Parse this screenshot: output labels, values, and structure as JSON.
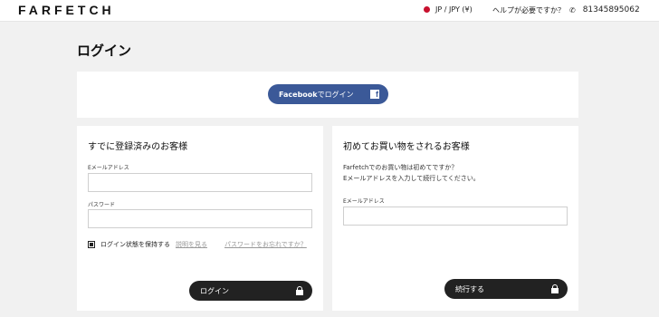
{
  "header": {
    "logo": "FARFETCH",
    "locale": "JP / JPY (¥)",
    "help": "ヘルプが必要ですか？",
    "phone": "81345895062",
    "icons": {
      "flag": "japan-flag-icon",
      "phone": "phone-icon"
    },
    "colors": {
      "flag": "#c8102e"
    }
  },
  "page": {
    "title": "ログイン"
  },
  "facebook": {
    "brand": "Facebook",
    "label": "でログイン",
    "icon_letter": "f",
    "color": "#3b5998"
  },
  "existing_customer": {
    "title": "すでに登録済みのお客様",
    "email_label": "Eメールアドレス",
    "email_value": "",
    "password_label": "パスワード",
    "password_value": "",
    "remember_label": "ログイン状態を保持する",
    "remember_checked": true,
    "explain_link": "説明を見る",
    "forgot_link": "パスワードをお忘れですか？",
    "login_button": "ログイン"
  },
  "new_customer": {
    "title": "初めてお買い物をされるお客様",
    "intro_line1": "Farfetchでのお買い物は初めてですか？",
    "intro_line2": "Eメールアドレスを入力して続行してください。",
    "email_label": "Eメールアドレス",
    "email_value": "",
    "continue_button": "続行する"
  }
}
